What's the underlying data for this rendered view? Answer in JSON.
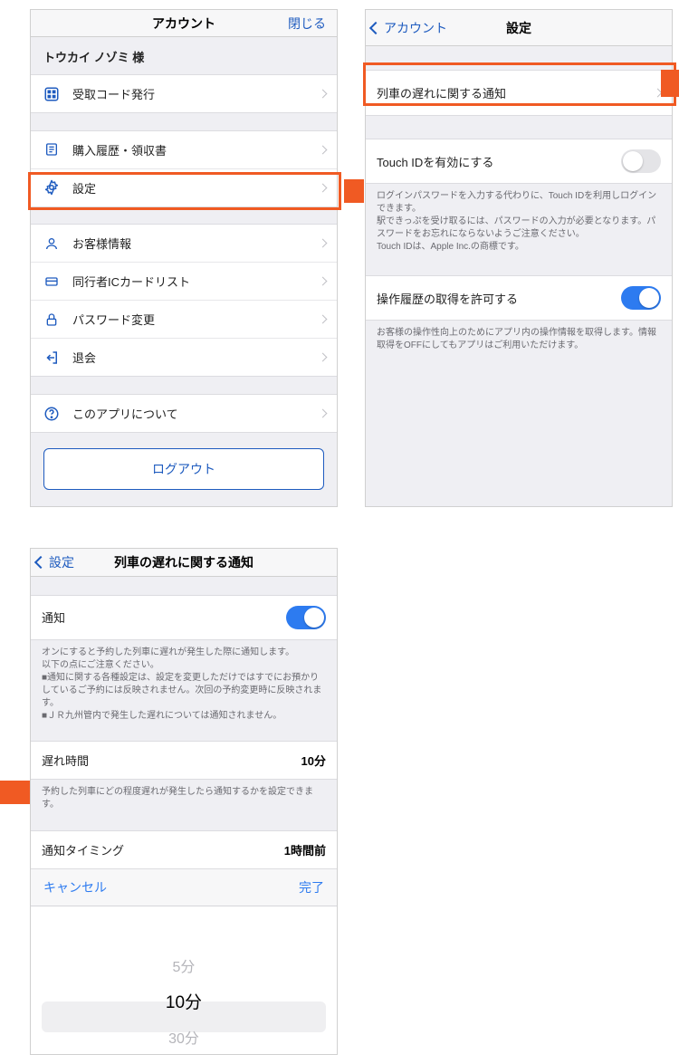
{
  "screen1": {
    "title": "アカウント",
    "close": "閉じる",
    "user": "トウカイ ノゾミ 様",
    "items": {
      "pickup": "受取コード発行",
      "history": "購入履歴・領収書",
      "settings": "設定",
      "customer": "お客様情報",
      "companion": "同行者ICカードリスト",
      "password": "パスワード変更",
      "withdraw": "退会",
      "about": "このアプリについて"
    },
    "logout": "ログアウト"
  },
  "screen2": {
    "back": "アカウント",
    "title": "設定",
    "delay_notice": "列車の遅れに関する通知",
    "touch_id": "Touch IDを有効にする",
    "touch_id_help": "ログインパスワードを入力する代わりに、Touch IDを利用しログインできます。\n駅できっぷを受け取るには、パスワードの入力が必要となります。パスワードをお忘れにならないようご注意ください。\nTouch IDは、Apple Inc.の商標です。",
    "history_consent": "操作履歴の取得を許可する",
    "history_help": "お客様の操作性向上のためにアプリ内の操作情報を取得します。情報取得をOFFにしてもアプリはご利用いただけます。"
  },
  "screen3": {
    "back": "設定",
    "title": "列車の遅れに関する通知",
    "notify_label": "通知",
    "notify_help": "オンにすると予約した列車に遅れが発生した際に通知します。\n以下の点にご注意ください。\n■通知に関する各種設定は、設定を変更しただけではすでにお預かりしているご予約には反映されません。次回の予約変更時に反映されます。\n■ＪＲ九州管内で発生した遅れについては通知されません。",
    "delay_time_label": "遅れ時間",
    "delay_time_value": "10分",
    "delay_time_help": "予約した列車にどの程度遅れが発生したら通知するかを設定できます。",
    "timing_label": "通知タイミング",
    "timing_value": "1時間前",
    "picker_cancel": "キャンセル",
    "picker_done": "完了",
    "picker_options": [
      "5分",
      "10分",
      "30分"
    ]
  }
}
